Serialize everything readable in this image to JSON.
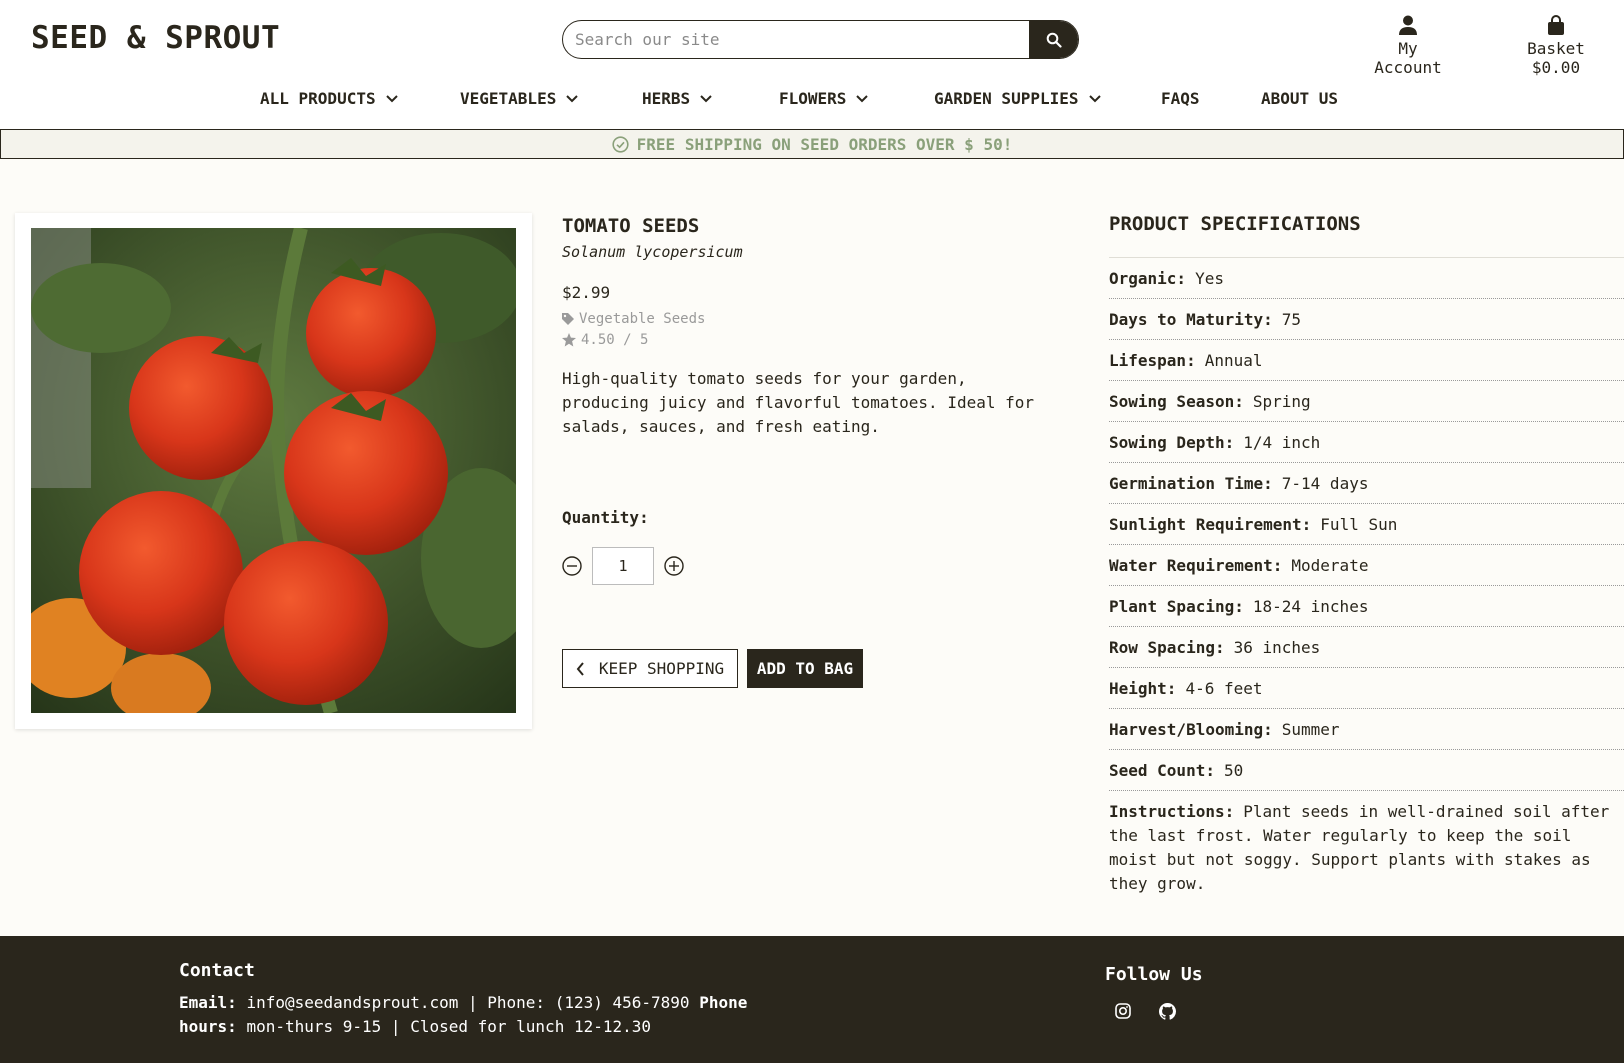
{
  "header": {
    "brand": "SEED & SPROUT",
    "search_placeholder": "Search our site",
    "account_label": "My Account",
    "basket_label": "Basket $0.00"
  },
  "nav": {
    "items": [
      {
        "label": "ALL PRODUCTS",
        "dropdown": true
      },
      {
        "label": "VEGETABLES",
        "dropdown": true
      },
      {
        "label": "HERBS",
        "dropdown": true
      },
      {
        "label": "FLOWERS",
        "dropdown": true
      },
      {
        "label": "GARDEN SUPPLIES",
        "dropdown": true
      },
      {
        "label": "FAQS",
        "dropdown": false
      },
      {
        "label": "ABOUT US",
        "dropdown": false
      }
    ]
  },
  "banner": {
    "text": "FREE SHIPPING ON SEED ORDERS OVER $ 50!"
  },
  "product": {
    "name": "TOMATO SEEDS",
    "scientific_name": "Solanum lycopersicum",
    "price": "$2.99",
    "category": "Vegetable Seeds",
    "rating": "4.50 / 5",
    "description": "High-quality tomato seeds for your garden, producing juicy and flavorful tomatoes. Ideal for salads, sauces, and fresh eating.",
    "quantity_label": "Quantity:",
    "quantity": "1",
    "keep_shopping_label": "KEEP SHOPPING",
    "add_to_bag_label": "ADD TO BAG"
  },
  "specs": {
    "title": "PRODUCT SPECIFICATIONS",
    "rows": [
      {
        "key": "Organic:",
        "value": "Yes"
      },
      {
        "key": "Days to Maturity:",
        "value": "75"
      },
      {
        "key": "Lifespan:",
        "value": "Annual"
      },
      {
        "key": "Sowing Season:",
        "value": "Spring"
      },
      {
        "key": "Sowing Depth:",
        "value": "1/4 inch"
      },
      {
        "key": "Germination Time:",
        "value": "7-14 days"
      },
      {
        "key": "Sunlight Requirement:",
        "value": "Full Sun"
      },
      {
        "key": "Water Requirement:",
        "value": "Moderate"
      },
      {
        "key": "Plant Spacing:",
        "value": "18-24 inches"
      },
      {
        "key": "Row Spacing:",
        "value": "36 inches"
      },
      {
        "key": "Height:",
        "value": "4-6 feet"
      },
      {
        "key": "Harvest/Blooming:",
        "value": "Summer"
      },
      {
        "key": "Seed Count:",
        "value": "50"
      }
    ],
    "instructions_key": "Instructions:",
    "instructions_value": "Plant seeds in well-drained soil after the last frost. Water regularly to keep the soil moist but not soggy. Support plants with stakes as they grow."
  },
  "footer": {
    "contact_title": "Contact",
    "email_key": "Email:",
    "email_value": "info@seedandsprout.com | Phone: (123) 456-7890",
    "hours_key": "Phone hours:",
    "hours_value": "mon-thurs 9-15 | Closed for lunch 12-12.30",
    "follow_title": "Follow Us",
    "socials": [
      "instagram-icon",
      "github-icon"
    ]
  },
  "colors": {
    "brand_dark": "#2a261c",
    "banner_text": "#8aa07a",
    "page_bg": "#fdfcf8"
  }
}
